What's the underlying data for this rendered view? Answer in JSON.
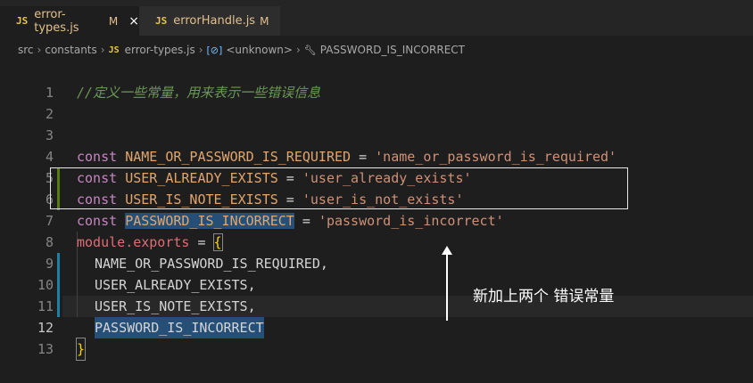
{
  "tabs": [
    {
      "icon": "JS",
      "name": "error-types.js",
      "modified": "M",
      "close": "×"
    },
    {
      "icon": "JS",
      "name": "errorHandle.js",
      "modified": "M"
    }
  ],
  "breadcrumb": {
    "src": "src",
    "constants": "constants",
    "file_icon": "JS",
    "file": "error-types.js",
    "symbol_icon": "[⊘]",
    "unknown": "<unknown>",
    "item": "PASSWORD_IS_INCORRECT"
  },
  "code": {
    "line1": "1",
    "line2": "2",
    "line3": "3",
    "line4": "4",
    "line5": "5",
    "line6": "6",
    "line7": "7",
    "line8": "8",
    "line9": "9",
    "line10": "10",
    "line11": "11",
    "line12": "12",
    "line13": "13",
    "comment": "//定义一些常量，用来表示一些错误信息",
    "kw_const": "const",
    "c_name_req": "NAME_OR_PASSWORD_IS_REQUIRED",
    "s_name_req": "'name_or_password_is_required'",
    "c_user_exists": "USER_ALREADY_EXISTS",
    "s_user_exists": "'user_already_exists'",
    "c_user_note": "USER_IS_NOTE_EXISTS",
    "s_user_note": "'user_is_not_exists'",
    "c_pwd": "PASSWORD_IS_INCORRECT",
    "s_pwd": "'password_is_incorrect'",
    "eq": " = ",
    "module": "module",
    "exports": ".exports",
    "open_brace": "{",
    "close_brace": "}",
    "e1": "NAME_OR_PASSWORD_IS_REQUIRED,",
    "e2": "USER_ALREADY_EXISTS,",
    "e3": "USER_IS_NOTE_EXISTS,",
    "e4": "PASSWORD_IS_INCORRECT"
  },
  "annotation": "新加上两个 错误常量"
}
